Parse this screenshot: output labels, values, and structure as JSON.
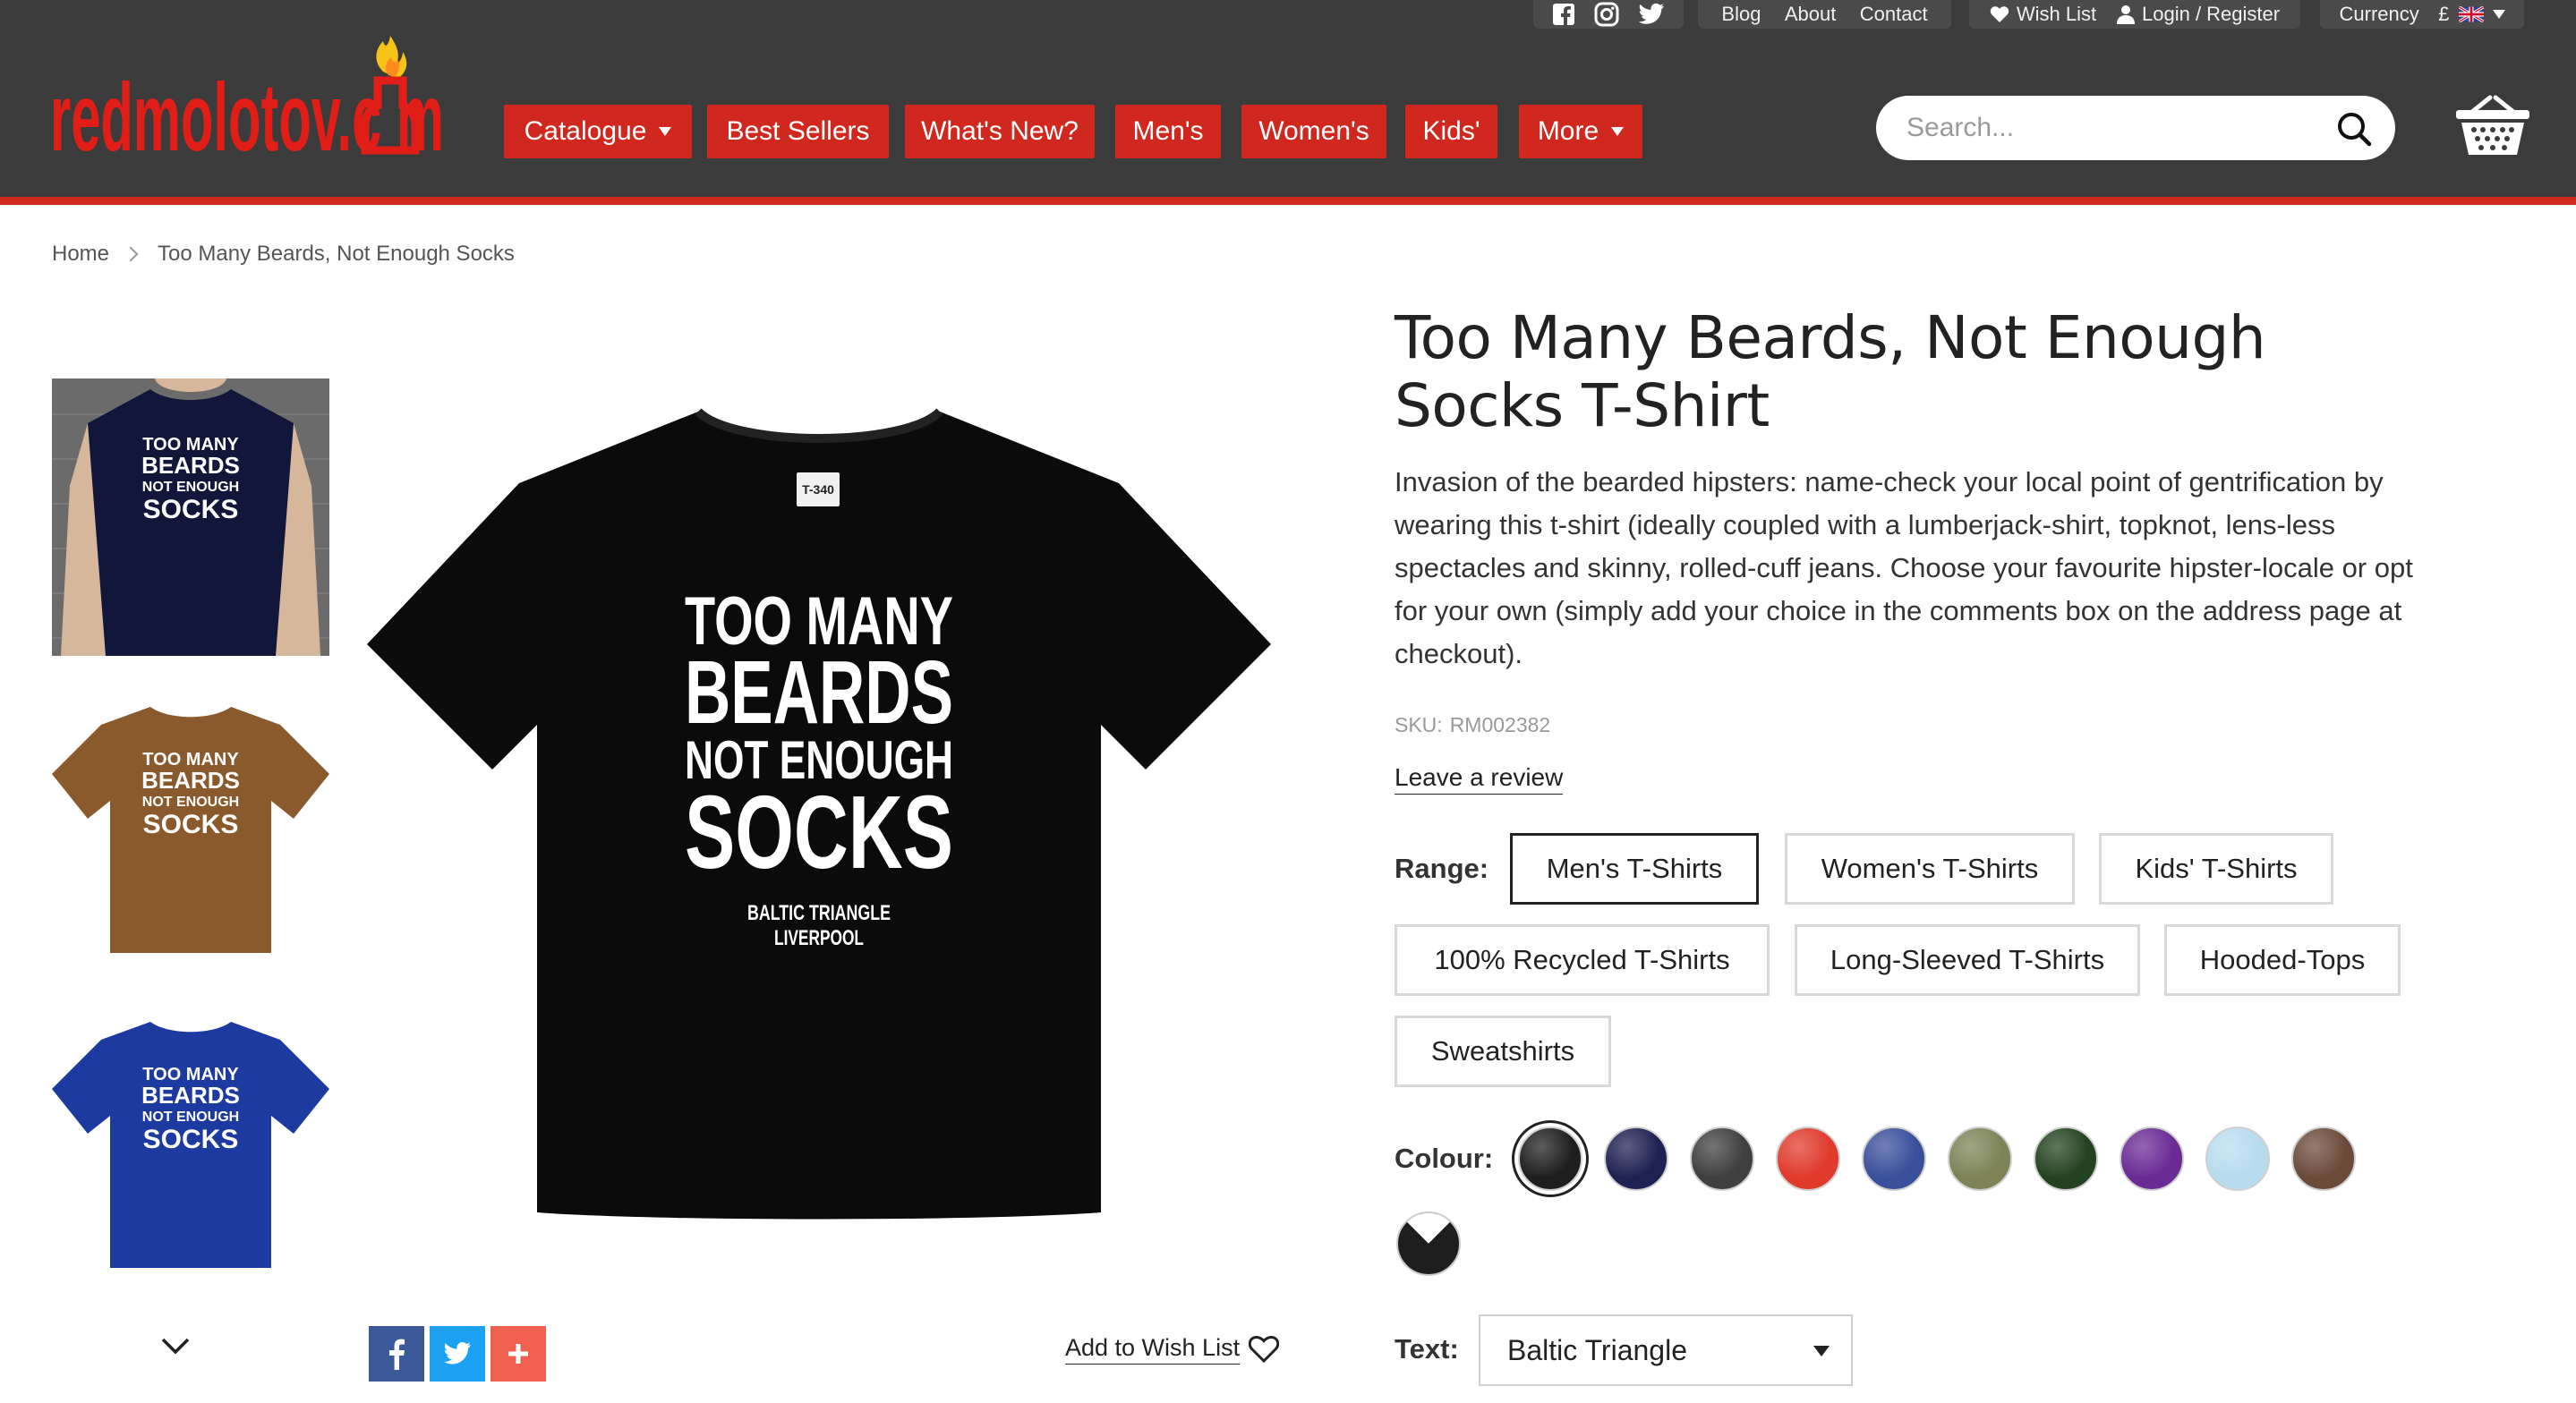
{
  "header": {
    "brand": "redmolotov.com",
    "top_links": {
      "blog": "Blog",
      "about": "About",
      "contact": "Contact",
      "wish_list": "Wish List",
      "login": "Login / Register",
      "currency": "Currency",
      "currency_symbol": "£"
    },
    "social_icons": [
      "facebook-icon",
      "instagram-icon",
      "twitter-icon"
    ],
    "nav": {
      "catalogue": "Catalogue",
      "best_sellers": "Best Sellers",
      "whats_new": "What's New?",
      "mens": "Men's",
      "womens": "Women's",
      "kids": "Kids'",
      "more": "More"
    },
    "search": {
      "placeholder": "Search...",
      "value": ""
    },
    "colors": {
      "bar": "#3b3b3b",
      "accent": "#d0271f"
    }
  },
  "breadcrumb": {
    "home": "Home",
    "current": "Too Many Beards, Not Enough Socks"
  },
  "product": {
    "title": "Too Many Beards, Not Enough Socks T-Shirt",
    "description": "Invasion of the bearded hipsters: name-check your local point of gentrification by wearing this t-shirt (ideally coupled with a lumberjack-shirt, topknot, lens-less spectacles and skinny, rolled-cuff jeans. Choose your favourite hipster-locale or opt for your own (simply add your choice in the comments box on the address page at checkout).",
    "sku_label": "SKU:",
    "sku": "RM002382",
    "review_link": "Leave a review",
    "shirt_text": {
      "line1": "TOO MANY",
      "line2": "BEARDS",
      "line3": "NOT ENOUGH",
      "line4": "SOCKS",
      "place1": "BALTIC TRIANGLE",
      "place2": "LIVERPOOL",
      "tag": "T-340"
    },
    "range_label": "Range:",
    "ranges": [
      "Men's T-Shirts",
      "Women's T-Shirts",
      "Kids' T-Shirts",
      "100% Recycled T-Shirts",
      "Long-Sleeved T-Shirts",
      "Hooded-Tops",
      "Sweatshirts"
    ],
    "selected_range": "Men's T-Shirts",
    "colour_label": "Colour:",
    "colours": [
      "#1e1e1e",
      "#1f2152",
      "#3f3f3f",
      "#e03a2c",
      "#3a4f9a",
      "#7d8356",
      "#23421f",
      "#6a2b94",
      "#b7dcef",
      "#6b4a3a",
      "two-tone"
    ],
    "selected_colour": "#1e1e1e",
    "text_label": "Text:",
    "text_value": "Baltic Triangle",
    "wish_link": "Add to Wish List",
    "thumb_colors": [
      "#12163a",
      "#8a5a2c",
      "#1d3aa0"
    ]
  }
}
